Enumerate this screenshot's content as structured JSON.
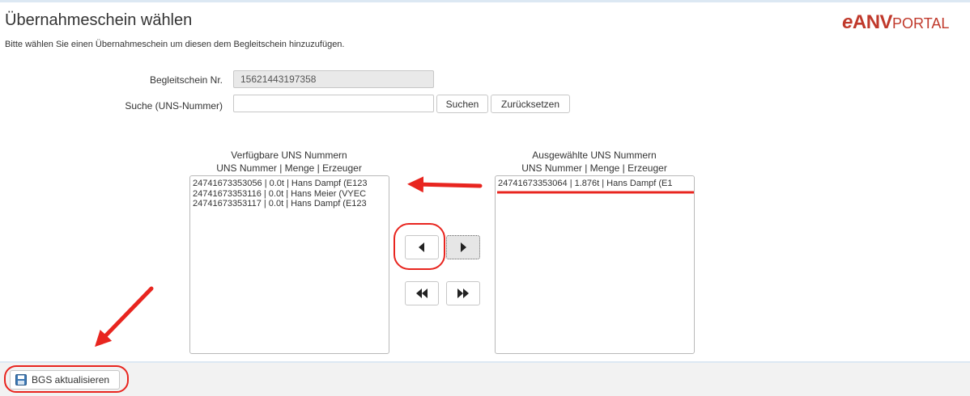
{
  "header": {
    "title": "Übernahmeschein wählen",
    "subtitle": "Bitte wählen Sie einen Übernahmeschein um diesen dem Begleitschein hinzuzufügen.",
    "logo_e": "e",
    "logo_anv": "ANV",
    "logo_portal": "PORTAL"
  },
  "form": {
    "begleitschein_label": "Begleitschein Nr.",
    "begleitschein_value": "15621443197358",
    "suche_label": "Suche (UNS-Nummer)",
    "suche_value": "",
    "suchen_button": "Suchen",
    "reset_button": "Zurücksetzen"
  },
  "available": {
    "title": "Verfügbare UNS Nummern",
    "header": "UNS Nummer | Menge | Erzeuger",
    "items": [
      "24741673353056 | 0.0t | Hans Dampf (E123",
      "24741673353116 | 0.0t | Hans Meier (VYEC",
      "24741673353117 | 0.0t | Hans Dampf (E123"
    ]
  },
  "selected": {
    "title": "Ausgewählte UNS Nummern",
    "header": "UNS Nummer | Menge | Erzeuger",
    "items": [
      "24741673353064 | 1.876t | Hans Dampf (E1"
    ]
  },
  "footer": {
    "save_button": "BGS aktualisieren"
  },
  "colors": {
    "annotation": "#e8251f",
    "logo": "#c0392b",
    "accent_line": "#dce8f3"
  },
  "icons": {
    "move_left": "triangle-left-icon",
    "move_right": "triangle-right-icon",
    "move_all_left": "double-triangle-left-icon",
    "move_all_right": "double-triangle-right-icon",
    "save": "floppy-disk-icon"
  }
}
